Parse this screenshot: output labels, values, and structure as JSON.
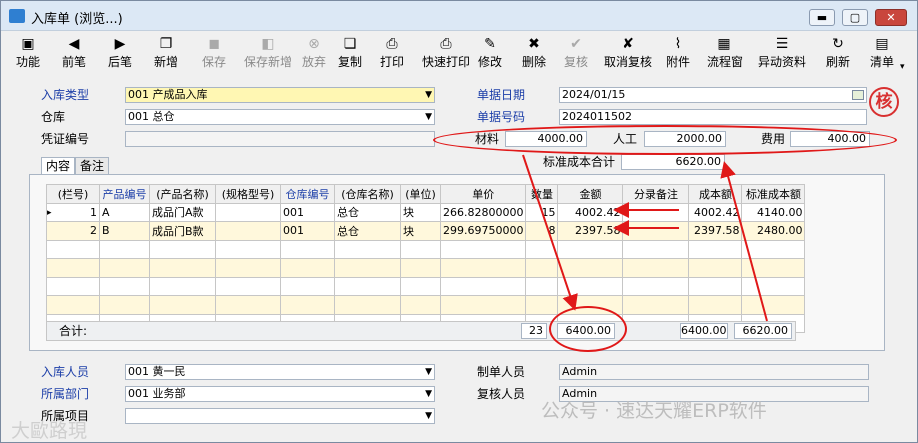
{
  "window": {
    "title": "入库单 (浏览...)",
    "min_label": "▬",
    "max_label": "▢",
    "close_label": "✕"
  },
  "toolbar": [
    {
      "label": "功能",
      "icon": "▣",
      "icon_name": "function-icon",
      "enabled": true
    },
    {
      "label": "前笔",
      "icon": "◀",
      "icon_name": "prev-icon",
      "enabled": true
    },
    {
      "label": "后笔",
      "icon": "▶",
      "icon_name": "next-icon",
      "enabled": true
    },
    {
      "label": "新增",
      "icon": "❐",
      "icon_name": "new-icon",
      "enabled": true
    },
    {
      "label": "保存",
      "icon": "◼",
      "icon_name": "save-icon",
      "enabled": false
    },
    {
      "label": "保存新增",
      "icon": "◧",
      "icon_name": "save-new-icon",
      "enabled": false
    },
    {
      "label": "放弃",
      "icon": "⊗",
      "icon_name": "discard-icon",
      "enabled": false
    },
    {
      "label": "复制",
      "icon": "❏",
      "icon_name": "copy-icon",
      "enabled": true
    },
    {
      "label": "打印",
      "icon": "⎙",
      "icon_name": "print-icon",
      "enabled": true
    },
    {
      "label": "快速打印",
      "icon": "⎙",
      "icon_name": "quick-print-icon",
      "enabled": true
    },
    {
      "label": "修改",
      "icon": "✎",
      "icon_name": "edit-icon",
      "enabled": true
    },
    {
      "label": "删除",
      "icon": "✖",
      "icon_name": "delete-icon",
      "enabled": true
    },
    {
      "label": "复核",
      "icon": "✔",
      "icon_name": "review-icon",
      "enabled": false
    },
    {
      "label": "取消复核",
      "icon": "✘",
      "icon_name": "cancel-review-icon",
      "enabled": true
    },
    {
      "label": "附件",
      "icon": "⌇",
      "icon_name": "attachment-icon",
      "enabled": true
    },
    {
      "label": "流程窗",
      "icon": "▦",
      "icon_name": "flow-window-icon",
      "enabled": true
    },
    {
      "label": "异动资料",
      "icon": "☰",
      "icon_name": "change-log-icon",
      "enabled": true
    },
    {
      "label": "刷新",
      "icon": "↻",
      "icon_name": "refresh-icon",
      "enabled": true
    },
    {
      "label": "清单",
      "icon": "▤",
      "icon_name": "list-icon",
      "enabled": true
    }
  ],
  "header": {
    "stock_type_label": "入库类型",
    "stock_type_value": "001 产成品入库",
    "warehouse_label": "仓库",
    "warehouse_value": "001 总仓",
    "voucher_label": "凭证编号",
    "voucher_value": "",
    "date_label": "单据日期",
    "date_value": "2024/01/15",
    "doc_no_label": "单据号码",
    "doc_no_value": "2024011502",
    "material_label": "材料",
    "material_value": "4000.00",
    "labor_label": "人工",
    "labor_value": "2000.00",
    "expense_label": "费用",
    "expense_value": "400.00",
    "std_cost_total_label": "标准成本合计",
    "std_cost_total_value": "6620.00",
    "stamp_text": "核"
  },
  "tabs": [
    {
      "label": "内容",
      "active": true
    },
    {
      "label": "备注",
      "active": false
    }
  ],
  "grid": {
    "columns": [
      "(栏号)",
      "产品编号",
      "(产品名称)",
      "(规格型号)",
      "仓库编号",
      "(仓库名称)",
      "(单位)",
      "单价",
      "数量",
      "金额",
      "分录备注",
      "成本额",
      "标准成本额"
    ],
    "rows": [
      [
        "1",
        "A",
        "成品门A款",
        "",
        "001",
        "总仓",
        "块",
        "266.82800000",
        "15",
        "4002.42",
        "",
        "4002.42",
        "4140.00"
      ],
      [
        "2",
        "B",
        "成品门B款",
        "",
        "001",
        "总仓",
        "块",
        "299.69750000",
        "8",
        "2397.58",
        "",
        "2397.58",
        "2480.00"
      ]
    ],
    "row_marker": "▸",
    "total_label": "合计:",
    "total_qty": "23",
    "total_amount": "6400.00",
    "total_cost": "6400.00",
    "total_std_cost": "6620.00"
  },
  "footer": {
    "receiver_label": "入库人员",
    "receiver_value": "001 黄一民",
    "dept_label": "所属部门",
    "dept_value": "001 业务部",
    "project_label": "所属项目",
    "project_value": "",
    "maker_label": "制单人员",
    "maker_value": "Admin",
    "reviewer_label": "复核人员",
    "reviewer_value": "Admin"
  },
  "watermarks": {
    "left": "大歐路現",
    "right": "公众号 · 速达天耀ERP软件"
  },
  "colors": {
    "annotation_red": "#e01818",
    "link_blue": "#1c3ea8",
    "highlight_yellow": "#fff7b3"
  }
}
